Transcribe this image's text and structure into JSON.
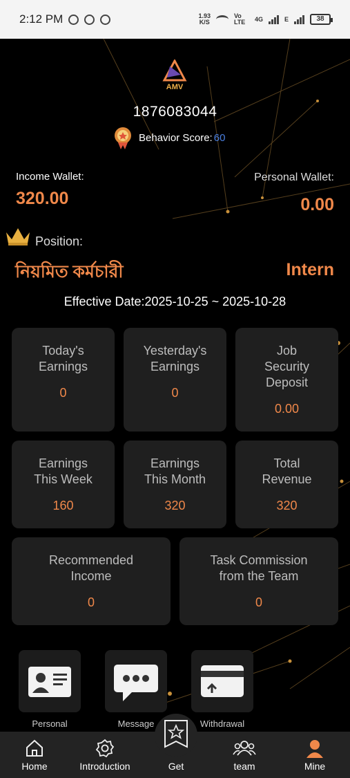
{
  "status_bar": {
    "time": "2:12 PM",
    "net_speed_value": "1.93",
    "net_speed_unit": "K/S",
    "volte": "Vo LTE",
    "network_4g": "4G",
    "network_e": "E",
    "battery": "38"
  },
  "profile": {
    "logo_text": "AMV",
    "phone": "1876083044",
    "behavior_label": "Behavior Score:",
    "behavior_score": "60"
  },
  "wallets": {
    "income_label": "Income Wallet:",
    "income_value": "320.00",
    "personal_label": "Personal Wallet:",
    "personal_value": "0.00"
  },
  "position": {
    "label": "Position:",
    "title_bn": "নিয়মিত কর্মচারী",
    "title_en": "Intern",
    "effective": "Effective Date:2025-10-25 ~ 2025-10-28"
  },
  "stats": [
    {
      "title": "Today's Earnings",
      "value": "0"
    },
    {
      "title": "Yesterday's Earnings",
      "value": "0"
    },
    {
      "title": "Job Security Deposit",
      "value": "0.00"
    },
    {
      "title": "Earnings This Week",
      "value": "160"
    },
    {
      "title": "Earnings This Month",
      "value": "320"
    },
    {
      "title": "Total Revenue",
      "value": "320"
    },
    {
      "title": "Recommended Income",
      "value": "0"
    },
    {
      "title": "Task Commission from the Team",
      "value": "0"
    }
  ],
  "quick_actions": [
    {
      "label": "Personal",
      "icon": "id-card-icon"
    },
    {
      "label": "Message",
      "icon": "message-icon"
    },
    {
      "label": "Withdrawal",
      "icon": "card-icon"
    }
  ],
  "nav": {
    "home": "Home",
    "introduction": "Introduction",
    "get": "Get",
    "team": "team",
    "mine": "Mine"
  },
  "colors": {
    "accent": "#f0884a",
    "score": "#4a7fe0",
    "card_bg": "#1f1f1f",
    "nav_bg": "#232323"
  }
}
